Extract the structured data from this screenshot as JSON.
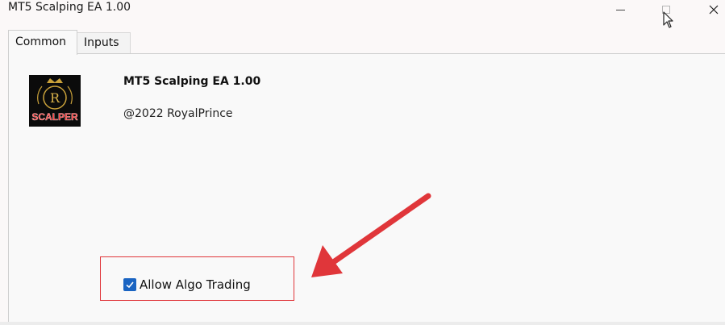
{
  "window": {
    "title": "MT5 Scalping EA 1.00",
    "controls": {
      "minimize": "minimize-icon",
      "maximize": "maximize-icon",
      "close": "close-icon"
    }
  },
  "tabs": [
    {
      "label": "Common",
      "active": true
    },
    {
      "label": "Inputs",
      "active": false
    }
  ],
  "expert": {
    "name": "MT5 Scalping EA 1.00",
    "copyright": "@2022 RoyalPrince",
    "logo_text": "SCALPER",
    "logo_monogram": "R"
  },
  "options": {
    "allow_algo_trading": {
      "label": "Allow Algo Trading",
      "checked": true
    }
  },
  "annotation": {
    "color": "#e0363a"
  },
  "colors": {
    "checkbox": "#1a64c2",
    "accent_red": "#e0363a"
  }
}
